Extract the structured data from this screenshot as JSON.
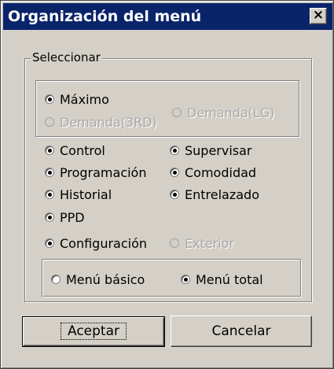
{
  "window": {
    "title": "Organización del menú",
    "close_label": "×"
  },
  "group_select": {
    "label": "Seleccionar"
  },
  "mode": {
    "maximo": {
      "label": "Máximo",
      "checked": true,
      "enabled": true
    },
    "demanda_3rd": {
      "label": "Demanda(3RD)",
      "checked": false,
      "enabled": false
    },
    "demanda_lg": {
      "label": "Demanda(LG)",
      "checked": false,
      "enabled": false
    }
  },
  "options": [
    {
      "label": "Control",
      "checked": true,
      "enabled": true
    },
    {
      "label": "Supervisar",
      "checked": true,
      "enabled": true
    },
    {
      "label": "Programación",
      "checked": true,
      "enabled": true
    },
    {
      "label": "Comodidad",
      "checked": true,
      "enabled": true
    },
    {
      "label": "Historial",
      "checked": true,
      "enabled": true
    },
    {
      "label": "Entrelazado",
      "checked": true,
      "enabled": true
    },
    {
      "label": "PPD",
      "checked": true,
      "enabled": true
    },
    {
      "label": "Configuración",
      "checked": true,
      "enabled": true
    },
    {
      "label": "Exterior",
      "checked": false,
      "enabled": false
    }
  ],
  "menu_type": {
    "basico": {
      "label": "Menú básico",
      "checked": false
    },
    "total": {
      "label": "Menú total",
      "checked": true
    }
  },
  "buttons": {
    "accept": "Aceptar",
    "cancel": "Cancelar"
  },
  "colors": {
    "face": "#d4d0c8",
    "titlebar": "#0a246a",
    "disabled_text": "#a8a8a8"
  }
}
